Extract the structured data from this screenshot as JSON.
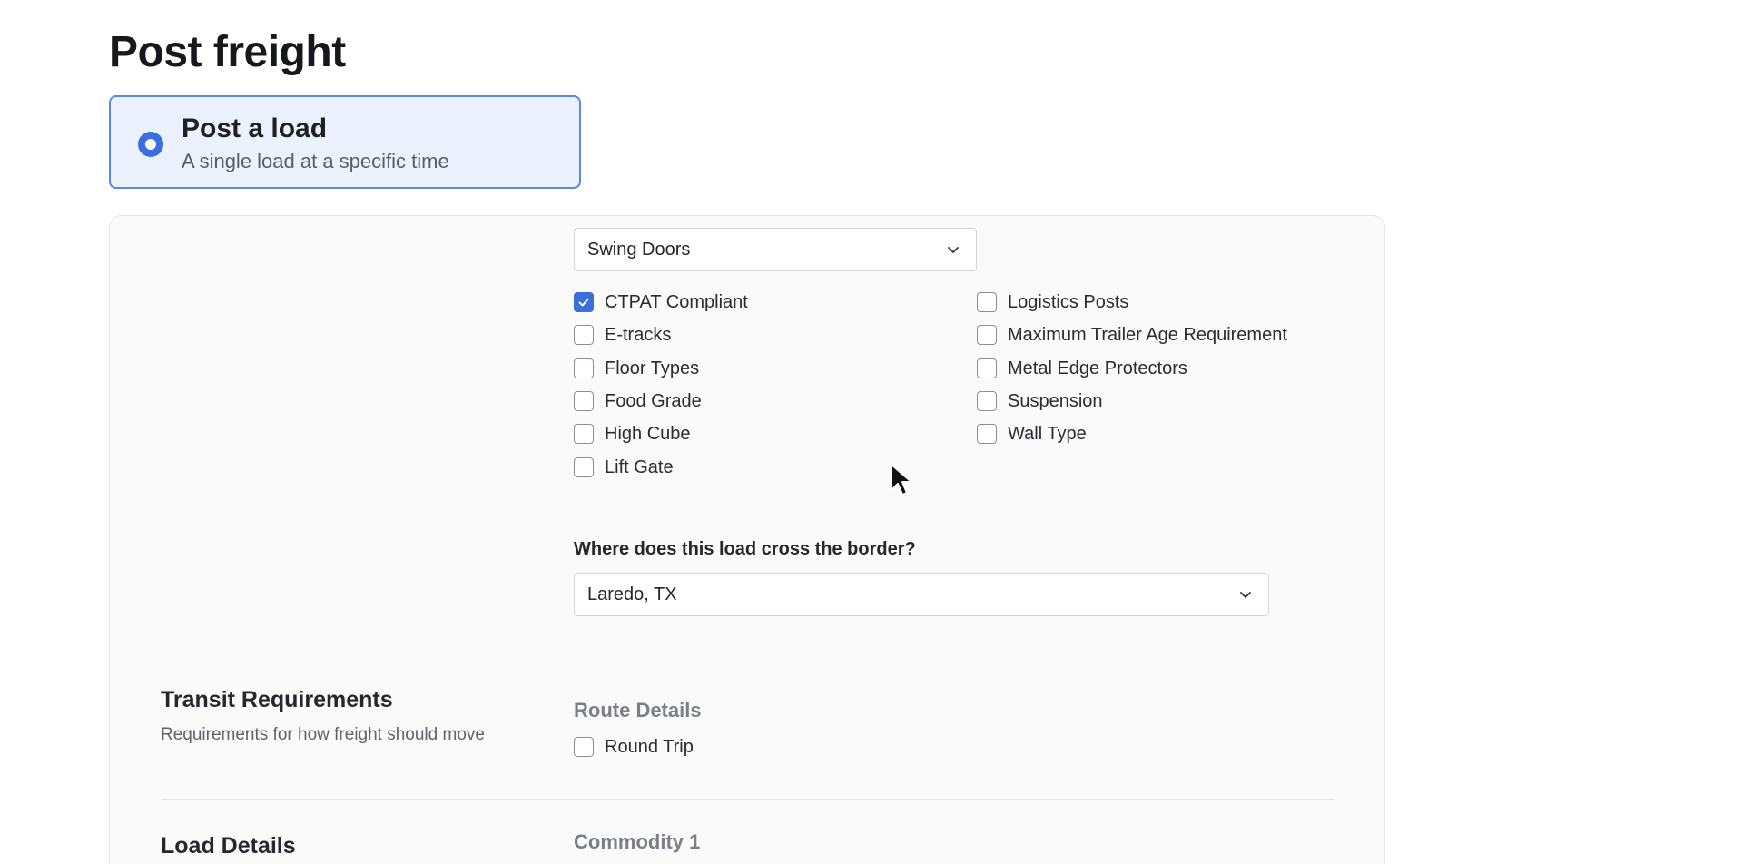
{
  "page": {
    "title": "Post freight"
  },
  "post_type": {
    "title": "Post a load",
    "subtitle": "A single load at a specific time",
    "selected": true
  },
  "equipment": {
    "door_type": {
      "value": "Swing Doors"
    },
    "options_left": [
      {
        "label": "CTPAT Compliant",
        "checked": true
      },
      {
        "label": "E-tracks",
        "checked": false
      },
      {
        "label": "Floor Types",
        "checked": false
      },
      {
        "label": "Food Grade",
        "checked": false
      },
      {
        "label": "High Cube",
        "checked": false
      },
      {
        "label": "Lift Gate",
        "checked": false
      }
    ],
    "options_right": [
      {
        "label": "Logistics Posts",
        "checked": false
      },
      {
        "label": "Maximum Trailer Age Requirement",
        "checked": false
      },
      {
        "label": "Metal Edge Protectors",
        "checked": false
      },
      {
        "label": "Suspension",
        "checked": false
      },
      {
        "label": "Wall Type",
        "checked": false
      }
    ]
  },
  "border": {
    "question": "Where does this load cross the border?",
    "value": "Laredo, TX"
  },
  "transit": {
    "title": "Transit Requirements",
    "description": "Requirements for how freight should move",
    "route_heading": "Route Details",
    "round_trip": {
      "label": "Round Trip",
      "checked": false
    }
  },
  "load_details": {
    "title": "Load Details",
    "commodity_heading": "Commodity 1"
  },
  "colors": {
    "accent": "#3b6fe0",
    "card_bg": "#ebf2fd",
    "panel_bg": "#fafafa"
  }
}
